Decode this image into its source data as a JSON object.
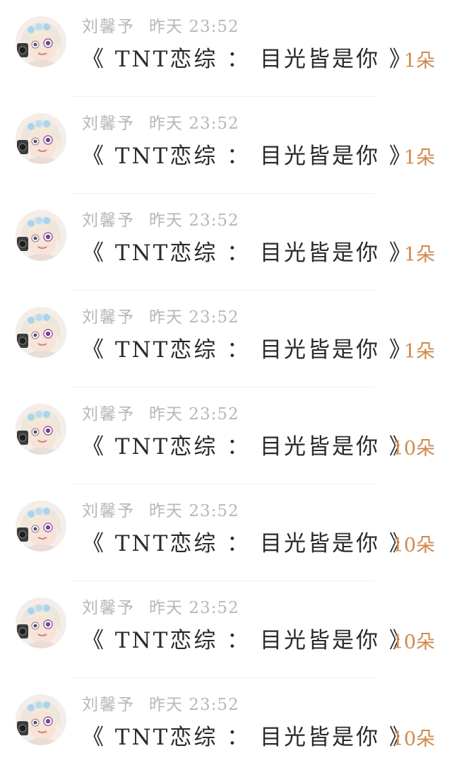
{
  "colors": {
    "background": "#ffffff",
    "meta_text": "#b7b7b7",
    "message_text": "#2a2a2a",
    "gift_text": "#d08a4c"
  },
  "records": [
    {
      "name": "刘馨予",
      "time": "昨天 23:52",
      "message": "《 TNT恋综 ： 目光皆是你 》",
      "gift": "1朵"
    },
    {
      "name": "刘馨予",
      "time": "昨天 23:52",
      "message": "《 TNT恋综 ： 目光皆是你 》",
      "gift": "1朵"
    },
    {
      "name": "刘馨予",
      "time": "昨天 23:52",
      "message": "《 TNT恋综 ： 目光皆是你 》",
      "gift": "1朵"
    },
    {
      "name": "刘馨予",
      "time": "昨天 23:52",
      "message": "《 TNT恋综 ： 目光皆是你 》",
      "gift": "1朵"
    },
    {
      "name": "刘馨予",
      "time": "昨天 23:52",
      "message": "《 TNT恋综 ： 目光皆是你 》",
      "gift": "10朵"
    },
    {
      "name": "刘馨予",
      "time": "昨天 23:52",
      "message": "《 TNT恋综 ： 目光皆是你 》",
      "gift": "10朵"
    },
    {
      "name": "刘馨予",
      "time": "昨天 23:52",
      "message": "《 TNT恋综 ： 目光皆是你 》",
      "gift": "10朵"
    },
    {
      "name": "刘馨予",
      "time": "昨天 23:52",
      "message": "《 TNT恋综 ： 目光皆是你 》",
      "gift": "10朵"
    }
  ]
}
